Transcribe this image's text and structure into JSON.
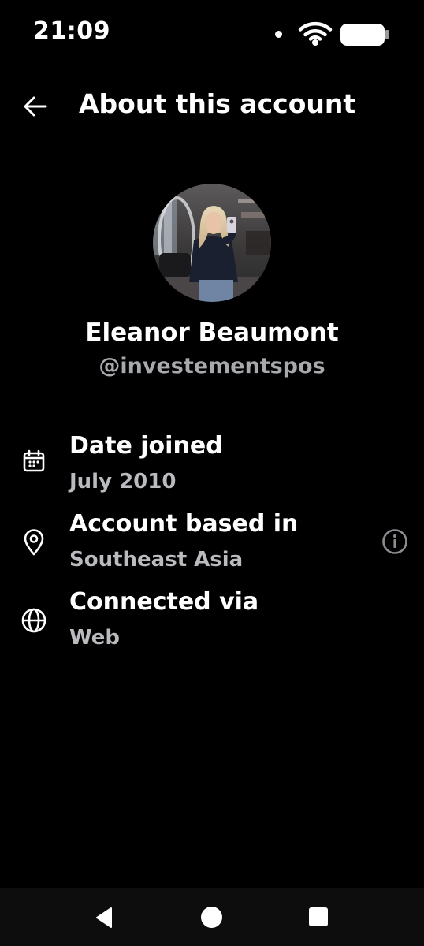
{
  "status_bar": {
    "time": "21:09"
  },
  "header": {
    "title": "About this account",
    "back_icon": "arrow-left-icon"
  },
  "profile": {
    "display_name": "Eleanor Beaumont",
    "handle": "@investementspos",
    "avatar": "profile-photo"
  },
  "details": [
    {
      "icon": "calendar-icon",
      "label": "Date joined",
      "value": "July 2010"
    },
    {
      "icon": "location-pin-icon",
      "label": "Account based in",
      "value": "Southeast Asia",
      "trailing_icon": "info-circle-icon"
    },
    {
      "icon": "globe-icon",
      "label": "Connected via",
      "value": "Web"
    }
  ],
  "colors": {
    "background": "#000000",
    "primary_text": "#ffffff",
    "secondary_text": "#a7a9ad",
    "nav_bar": "#0d0d0d"
  }
}
